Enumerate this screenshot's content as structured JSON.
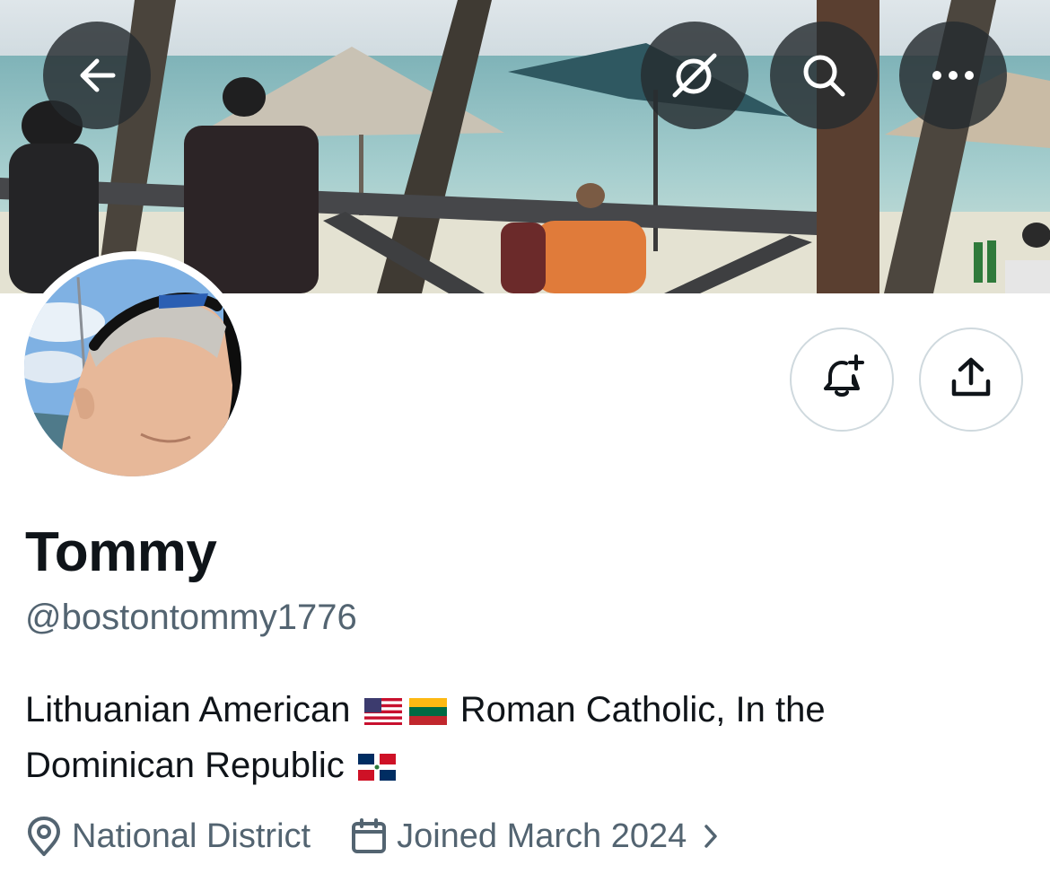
{
  "banner": {
    "back_icon": "arrow-left-icon",
    "grok_icon": "grok-icon",
    "search_icon": "search-icon",
    "more_icon": "more-horizontal-icon"
  },
  "actions": {
    "notify_icon": "bell-plus-icon",
    "share_icon": "share-icon"
  },
  "profile": {
    "display_name": "Tommy",
    "handle": "@bostontommy1776",
    "bio": {
      "part1": "Lithuanian American",
      "part2": "Roman Catholic, In the",
      "part3": "Dominican Republic",
      "flags": [
        "us-flag",
        "lithuania-flag",
        "dominican-republic-flag"
      ]
    },
    "location": "National District",
    "joined": "Joined March 2024"
  },
  "colors": {
    "text_primary": "#0f1419",
    "text_secondary": "#536471",
    "button_border": "#cfd9de",
    "overlay_button": "#262c30"
  }
}
